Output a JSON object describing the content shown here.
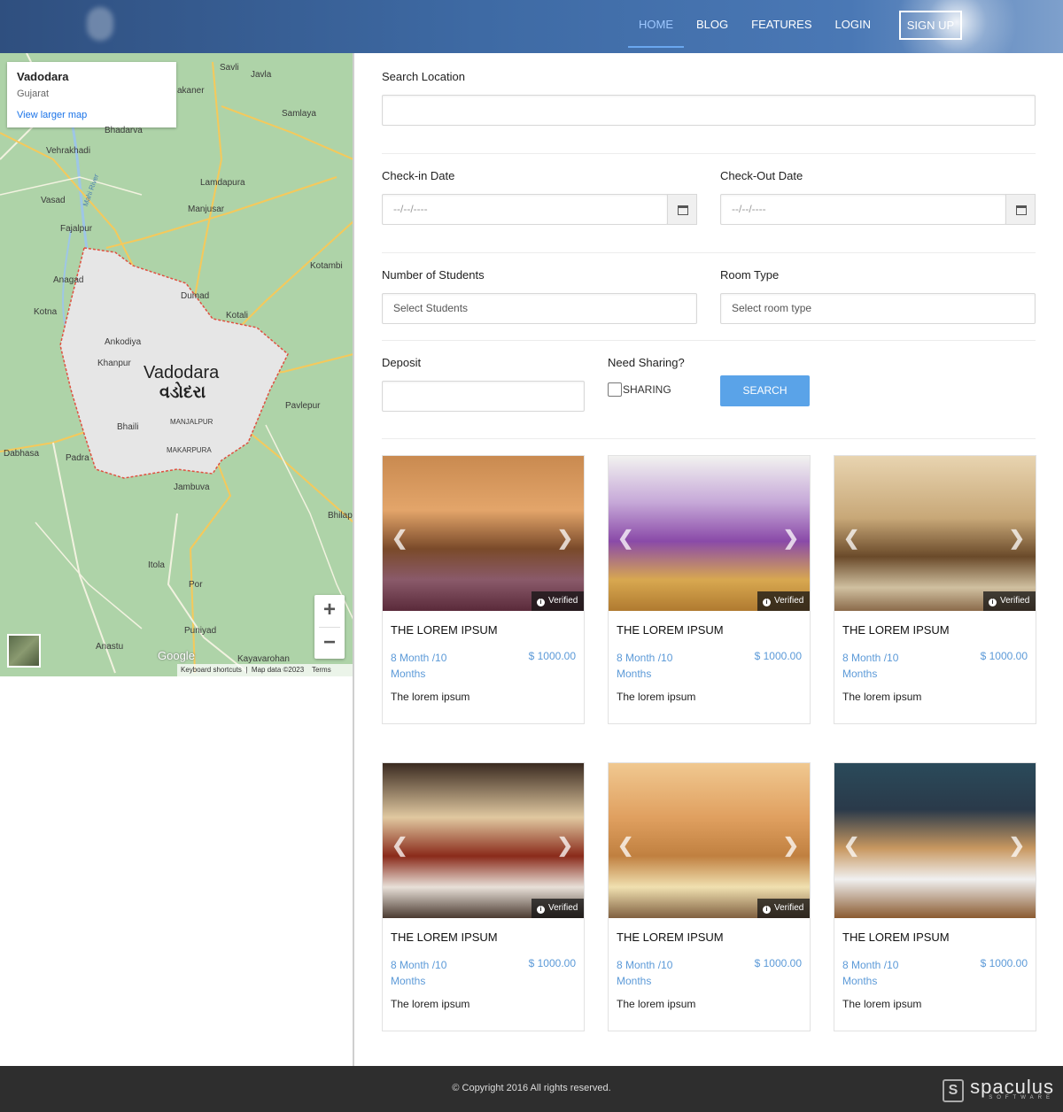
{
  "nav": {
    "items": [
      "HOME",
      "BLOG",
      "FEATURES",
      "LOGIN"
    ],
    "signup": "SIGN UP",
    "active": "HOME"
  },
  "map": {
    "card_city": "Vadodara",
    "card_state": "Gujarat",
    "card_link": "View larger map",
    "zoom_in": "+",
    "zoom_out": "−",
    "google": "Google",
    "footer_shortcuts": "Keyboard shortcuts",
    "footer_data": "Map data ©2023",
    "footer_terms": "Terms",
    "labels": {
      "savli": "Savli",
      "jawla": "Javla",
      "samlaya": "Samlaya",
      "kanera": "akaner",
      "bhadarva": "Bhadarva",
      "vehrakhadi": "Vehrakhadi",
      "lamdapura": "Lamdapura",
      "vasad": "Vasad",
      "manjusar": "Manjusar",
      "fajalpur": "Fajalpur",
      "anagad": "Anagad",
      "dumad": "Dumad",
      "kotambi": "Kotambi",
      "kotna": "Kotna",
      "kotali": "Kotali",
      "ankodiya": "Ankodiya",
      "khanpur": "Khanpur",
      "vadodara": "Vadodara",
      "vadodara_g": "વડોદરા",
      "manjalpur": "MANJALPUR",
      "pavlepur": "Pavlepur",
      "bhaili": "Bhaili",
      "makarpura": "MAKARPURA",
      "dabhasa": "Dabhasa",
      "padra": "Padra",
      "jambuva": "Jambuva",
      "bhilap": "Bhilap",
      "itola": "Itola",
      "por": "Por",
      "puniyad": "Puniyad",
      "anastu": "Anastu",
      "kayavarohan": "Kayavarohan",
      "river": "Mahi River"
    }
  },
  "form": {
    "search_location_label": "Search Location",
    "search_location_value": "",
    "checkin_label": "Check-in Date",
    "checkin_placeholder": "--/--/----",
    "checkout_label": "Check-Out Date",
    "checkout_placeholder": "--/--/----",
    "students_label": "Number of Students",
    "students_value": "Select Students",
    "room_label": "Room Type",
    "room_value": "Select room type",
    "deposit_label": "Deposit",
    "deposit_value": "",
    "sharing_label": "Need Sharing?",
    "sharing_option": "SHARING",
    "sharing_checked": false,
    "search_button": "SEARCH"
  },
  "listings": [
    {
      "title": "THE LOREM IPSUM",
      "duration": "8 Month /10 Months",
      "price": "$ 1000.00",
      "desc": "The lorem ipsum",
      "verified": "Verified"
    },
    {
      "title": "THE LOREM IPSUM",
      "duration": "8 Month /10 Months",
      "price": "$ 1000.00",
      "desc": "The lorem ipsum",
      "verified": "Verified"
    },
    {
      "title": "THE LOREM IPSUM",
      "duration": "8 Month /10 Months",
      "price": "$ 1000.00",
      "desc": "The lorem ipsum",
      "verified": "Verified"
    },
    {
      "title": "THE LOREM IPSUM",
      "duration": "8 Month /10 Months",
      "price": "$ 1000.00",
      "desc": "The lorem ipsum",
      "verified": "Verified"
    },
    {
      "title": "THE LOREM IPSUM",
      "duration": "8 Month /10 Months",
      "price": "$ 1000.00",
      "desc": "The lorem ipsum",
      "verified": "Verified"
    },
    {
      "title": "THE LOREM IPSUM",
      "duration": "8 Month /10 Months",
      "price": "$ 1000.00",
      "desc": "The lorem ipsum",
      "verified": ""
    }
  ],
  "footer": {
    "copyright": "© Copyright 2016 All rights reserved.",
    "brand": "spaculus",
    "brand_sub": "SOFTWARE"
  },
  "colors": {
    "accent": "#5aa3e8",
    "link": "#5c9ad8",
    "header": "#3e6aa4",
    "footer": "#2e2e2e"
  },
  "icons": [
    "calendar-icon",
    "verified-icon",
    "chevron-left-icon",
    "chevron-right-icon",
    "spaculus-logo"
  ]
}
